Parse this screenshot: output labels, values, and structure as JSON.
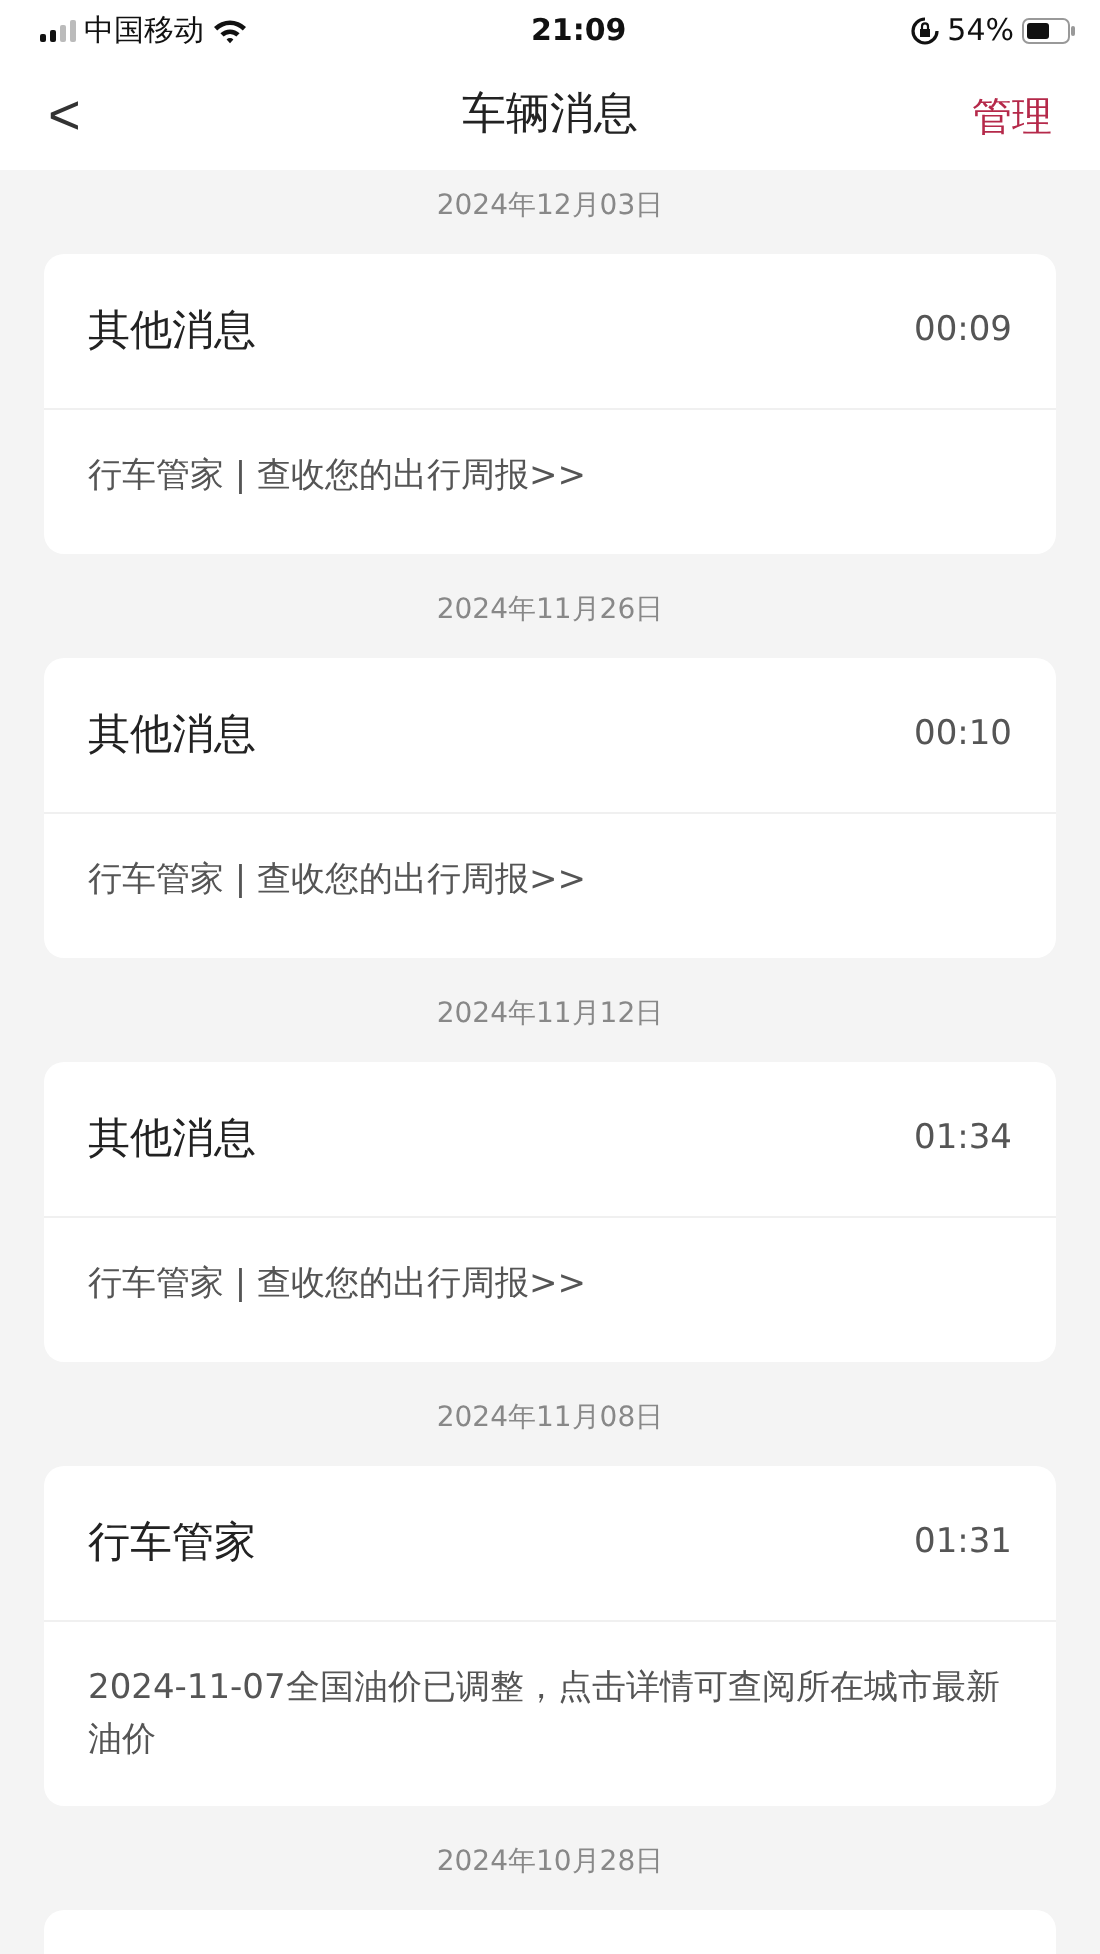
{
  "status_bar": {
    "carrier": "中国移动",
    "time": "21:09",
    "battery": "54%"
  },
  "nav": {
    "back": "<",
    "title": "车辆消息",
    "action": "管理"
  },
  "groups": [
    {
      "date": "2024年12月03日",
      "message": {
        "title": "其他消息",
        "time": "00:09",
        "body": "行车管家 | 查收您的出行周报>>"
      }
    },
    {
      "date": "2024年11月26日",
      "message": {
        "title": "其他消息",
        "time": "00:10",
        "body": "行车管家 | 查收您的出行周报>>"
      }
    },
    {
      "date": "2024年11月12日",
      "message": {
        "title": "其他消息",
        "time": "01:34",
        "body": "行车管家 | 查收您的出行周报>>"
      }
    },
    {
      "date": "2024年11月08日",
      "message": {
        "title": "行车管家",
        "time": "01:31",
        "body": "2024-11-07全国油价已调整，点击详情可查阅所在城市最新油价"
      }
    },
    {
      "date": "2024年10月28日"
    }
  ]
}
